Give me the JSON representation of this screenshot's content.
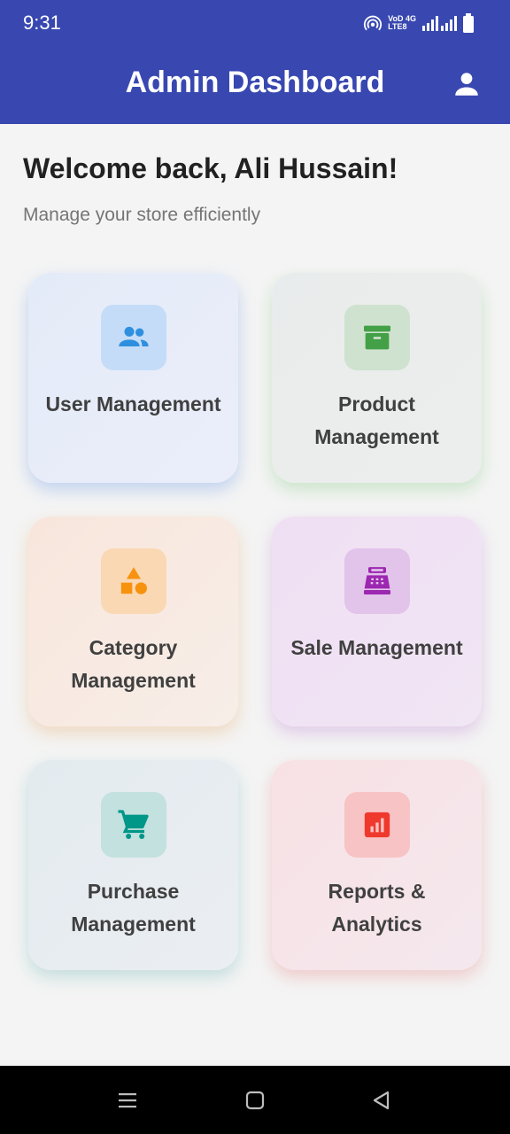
{
  "status_bar": {
    "time": "9:31",
    "network_top": "VoD 4G",
    "network_bottom": "LTE8"
  },
  "header": {
    "title": "Admin Dashboard",
    "profile_icon": "person-icon"
  },
  "welcome": {
    "title": "Welcome back, Ali Hussain!",
    "subtitle": "Manage your store efficiently"
  },
  "cards": [
    {
      "label": "User Management",
      "icon": "group-icon",
      "color": "#2f8fdf"
    },
    {
      "label": "Product Management",
      "icon": "archive-icon",
      "color": "#43a047"
    },
    {
      "label": "Category Management",
      "icon": "category-shapes-icon",
      "color": "#f7920e"
    },
    {
      "label": "Sale Management",
      "icon": "cash-register-icon",
      "color": "#9c27b0"
    },
    {
      "label": "Purchase Management",
      "icon": "shopping-cart-icon",
      "color": "#009688"
    },
    {
      "label": "Reports & Analytics",
      "icon": "bar-chart-icon",
      "color": "#f0392d"
    }
  ],
  "colors": {
    "app_bar": "#3848b0",
    "background": "#f4f4f4"
  },
  "nav": {
    "menu_icon": "menu-icon",
    "home_icon": "home-square-icon",
    "back_icon": "back-triangle-icon"
  }
}
